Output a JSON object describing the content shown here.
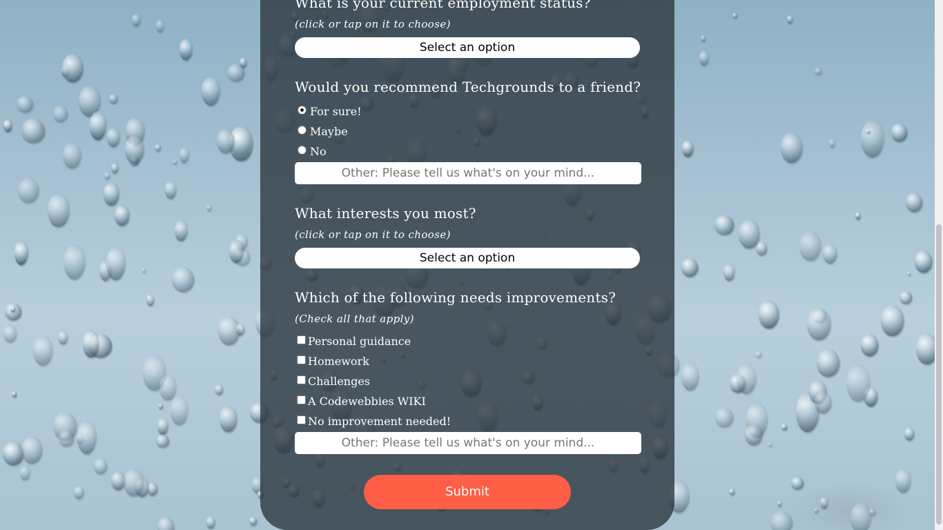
{
  "form": {
    "employment": {
      "question": "What is your current employment status?",
      "hint": "(click or tap on it to choose)",
      "select_value": "Select an option"
    },
    "recommend": {
      "question": "Would you recommend Techgrounds to a friend?",
      "options": [
        {
          "label": "For sure!",
          "checked": true
        },
        {
          "label": "Maybe",
          "checked": false
        },
        {
          "label": "No",
          "checked": false
        }
      ],
      "other_placeholder": "Other: Please tell us what's on your mind..."
    },
    "interests": {
      "question": "What interests you most?",
      "hint": "(click or tap on it to choose)",
      "select_value": "Select an option"
    },
    "improvements": {
      "question": "Which of the following needs improvements?",
      "hint": "(Check all that apply)",
      "options": [
        {
          "label": "Personal guidance",
          "checked": false
        },
        {
          "label": "Homework",
          "checked": false
        },
        {
          "label": "Challenges",
          "checked": false
        },
        {
          "label": "A Codewebbies WIKI",
          "checked": false
        },
        {
          "label": "No improvement needed!",
          "checked": false
        }
      ],
      "other_placeholder": "Other: Please tell us what's on your mind..."
    },
    "submit_label": "Submit"
  },
  "colors": {
    "panel": "#2a343c",
    "submit": "#fd5e45",
    "background": "#a7c2d3"
  }
}
